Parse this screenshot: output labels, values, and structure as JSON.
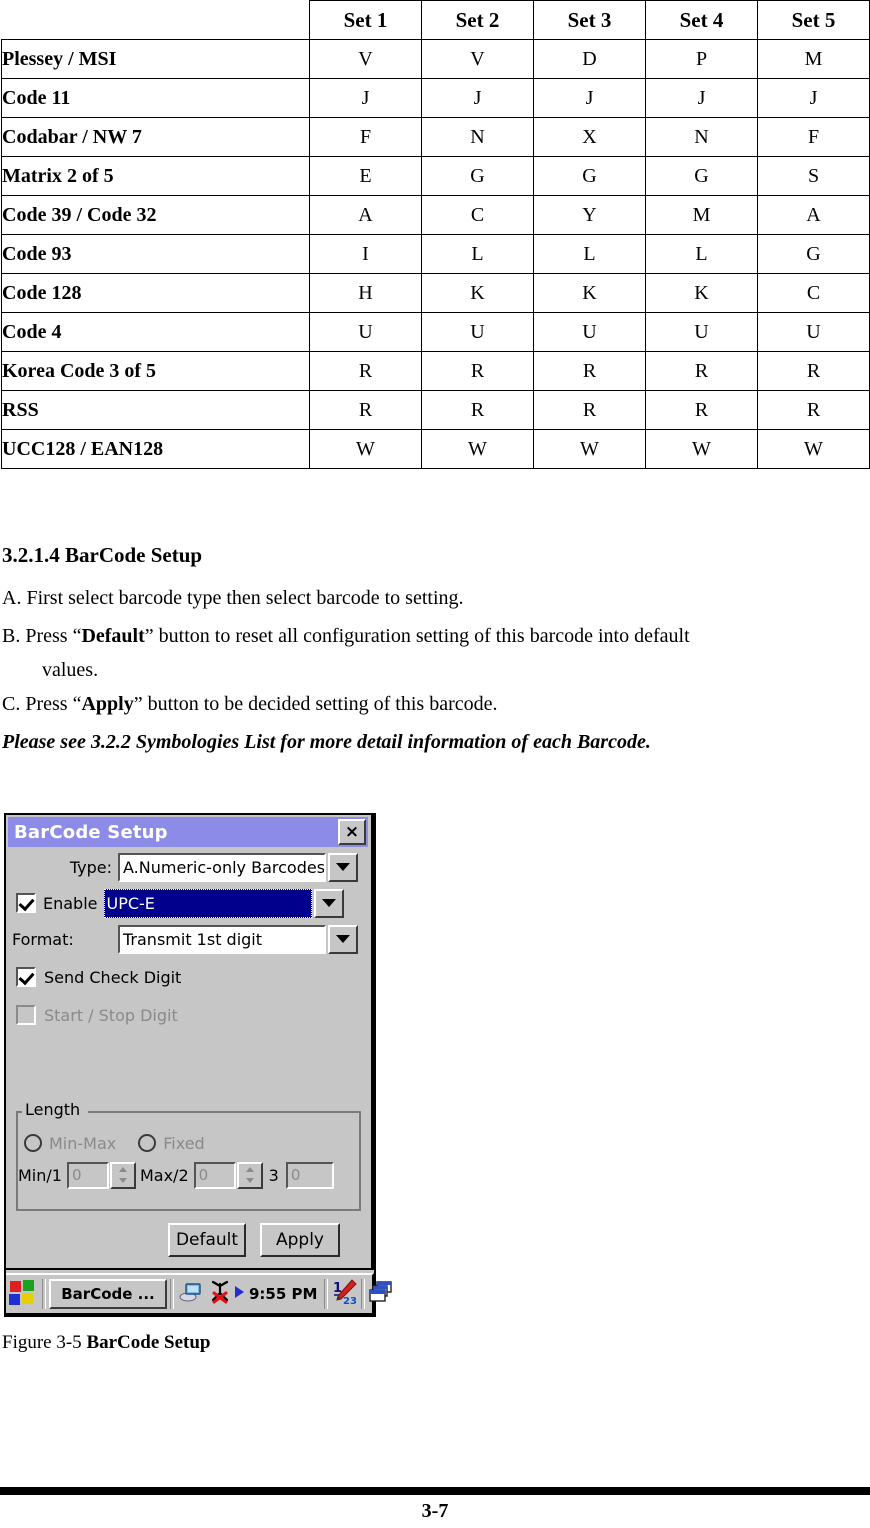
{
  "table": {
    "headers": [
      "",
      "Set 1",
      "Set 2",
      "Set 3",
      "Set 4",
      "Set 5"
    ],
    "rows": [
      {
        "name": "Plessey / MSI",
        "values": [
          "V",
          "V",
          "D",
          "P",
          "M"
        ]
      },
      {
        "name": "Code 11",
        "values": [
          "J",
          "J",
          "J",
          "J",
          "J"
        ]
      },
      {
        "name": "Codabar / NW 7",
        "values": [
          "F",
          "N",
          "X",
          "N",
          "F"
        ]
      },
      {
        "name": "Matrix 2 of 5",
        "values": [
          "E",
          "G",
          "G",
          "G",
          "S"
        ]
      },
      {
        "name": "Code 39 / Code 32",
        "values": [
          "A",
          "C",
          "Y",
          "M",
          "A"
        ]
      },
      {
        "name": "Code 93",
        "values": [
          "I",
          "L",
          "L",
          "L",
          "G"
        ]
      },
      {
        "name": "Code 128",
        "values": [
          "H",
          "K",
          "K",
          "K",
          "C"
        ]
      },
      {
        "name": "Code 4",
        "values": [
          "U",
          "U",
          "U",
          "U",
          "U"
        ]
      },
      {
        "name": "Korea Code 3 of 5",
        "values": [
          "R",
          "R",
          "R",
          "R",
          "R"
        ]
      },
      {
        "name": "RSS",
        "values": [
          "R",
          "R",
          "R",
          "R",
          "R"
        ]
      },
      {
        "name": "UCC128 / EAN128",
        "values": [
          "W",
          "W",
          "W",
          "W",
          "W"
        ]
      }
    ]
  },
  "section": {
    "heading": "3.2.1.4 BarCode Setup",
    "item_a": "A. First select barcode type then select barcode to setting.",
    "item_b_pre": "B. Press “",
    "item_b_bold": "Default",
    "item_b_post": "” button to reset all configuration setting of this barcode into default",
    "item_b_cont": "values.",
    "item_c_pre": "C. Press “",
    "item_c_bold": "Apply",
    "item_c_post": "” button to be decided setting of this barcode.",
    "note": "Please see 3.2.2 Symbologies List for more detail information of each Barcode."
  },
  "dialog": {
    "title": "BarCode Setup",
    "close_label": "×",
    "type_label": "Type:",
    "type_value": "A.Numeric-only Barcodes",
    "enable_label": "Enable",
    "enable_checked": true,
    "barcode_value": "UPC-E",
    "format_label": "Format:",
    "format_value": "Transmit 1st digit",
    "send_check_digit_label": "Send Check Digit",
    "send_check_digit_checked": true,
    "start_stop_digit_label": "Start / Stop Digit",
    "start_stop_digit_checked": false,
    "length_group_label": "Length",
    "radio_minmax_label": "Min-Max",
    "radio_fixed_label": "Fixed",
    "min_label": "Min/1",
    "min_value": "0",
    "max_label": "Max/2",
    "max_value": "0",
    "third_label": "3",
    "third_value": "0",
    "default_button": "Default",
    "apply_button": "Apply",
    "titlebar_color": "#8c8ce8",
    "face_color": "#c6c6c6",
    "selection_color": "#00008c"
  },
  "taskbar": {
    "task_label": "BarCode ...",
    "time": "9:55 PM"
  },
  "figure": {
    "caption_pre": "Figure 3-5 ",
    "caption_bold": "BarCode Setup"
  },
  "footer": {
    "page": "3-7"
  }
}
